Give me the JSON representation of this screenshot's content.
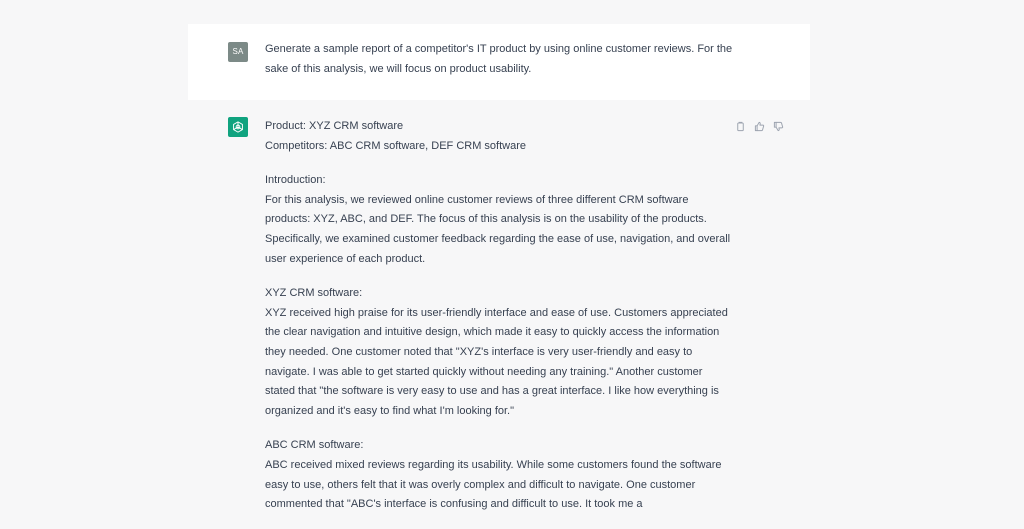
{
  "user": {
    "avatar_initials": "SA",
    "prompt": "Generate a sample report of a competitor's IT product by using online customer reviews. For the sake of this analysis, we will focus on product usability."
  },
  "assistant": {
    "icon": "openai-logo-icon",
    "accent_color": "#10a37f",
    "actions": {
      "copy": "copy-icon",
      "like": "thumbs-up-icon",
      "dislike": "thumbs-down-icon"
    },
    "paragraphs": [
      [
        "Product: XYZ CRM software",
        "Competitors: ABC CRM software, DEF CRM software"
      ],
      [
        "Introduction:",
        "For this analysis, we reviewed online customer reviews of three different CRM software products: XYZ, ABC, and DEF. The focus of this analysis is on the usability of the products. Specifically, we examined customer feedback regarding the ease of use, navigation, and overall user experience of each product."
      ],
      [
        "XYZ CRM software:",
        "XYZ received high praise for its user-friendly interface and ease of use. Customers appreciated the clear navigation and intuitive design, which made it easy to quickly access the information they needed. One customer noted that \"XYZ's interface is very user-friendly and easy to navigate. I was able to get started quickly without needing any training.\" Another customer stated that \"the software is very easy to use and has a great interface. I like how everything is organized and it's easy to find what I'm looking for.\""
      ],
      [
        "ABC CRM software:",
        "ABC received mixed reviews regarding its usability. While some customers found the software easy to use, others felt that it was overly complex and difficult to navigate. One customer commented that \"ABC's interface is confusing and difficult to use. It took me a"
      ]
    ]
  }
}
